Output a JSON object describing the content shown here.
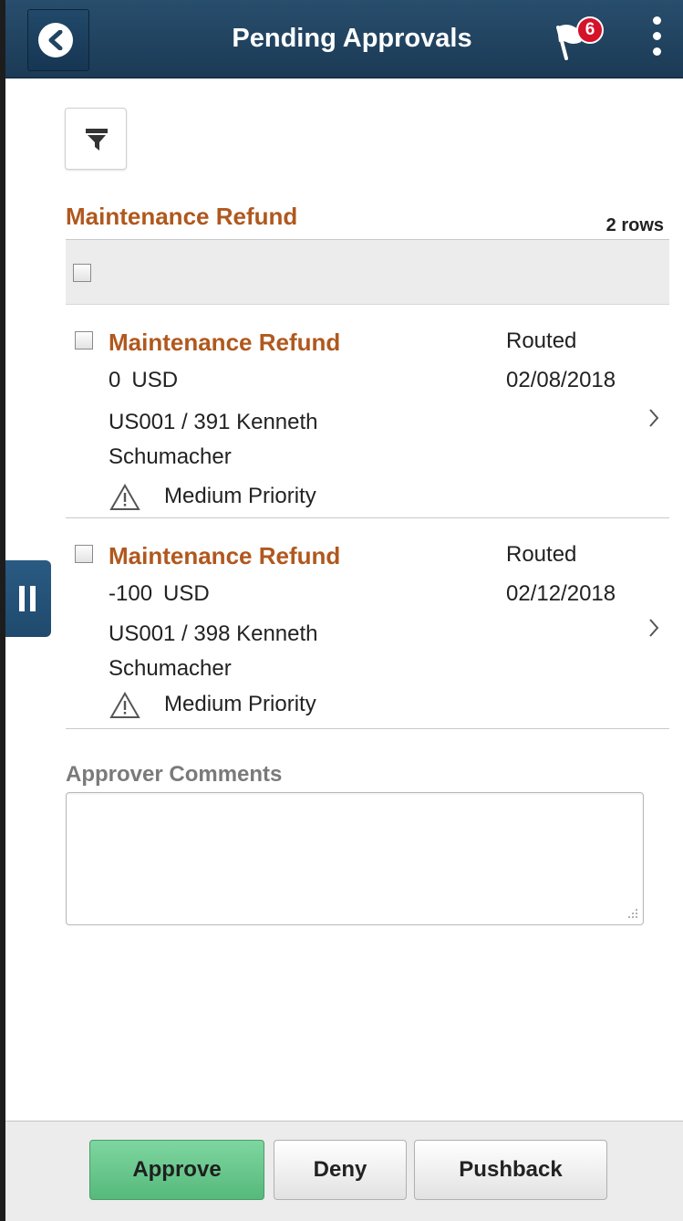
{
  "header": {
    "title": "Pending Approvals",
    "notification_count": "6"
  },
  "section": {
    "title": "Maintenance Refund",
    "row_count": "2 rows"
  },
  "items": [
    {
      "title": "Maintenance Refund",
      "amount": "0",
      "currency": "USD",
      "line1": "US001 / 391  Kenneth",
      "line2": "Schumacher",
      "priority": "Medium Priority",
      "status": "Routed",
      "date": "02/08/2018"
    },
    {
      "title": "Maintenance Refund",
      "amount": "-100",
      "currency": "USD",
      "line1": "US001 / 398  Kenneth",
      "line2": "Schumacher",
      "priority": "Medium Priority",
      "status": "Routed",
      "date": "02/12/2018"
    }
  ],
  "comments": {
    "label": "Approver Comments",
    "value": ""
  },
  "footer": {
    "approve_label": "Approve",
    "deny_label": "Deny",
    "pushback_label": "Pushback"
  },
  "colors": {
    "header_bg": "#1f4563",
    "accent": "#b0581e",
    "approve_bg": "#64c489",
    "badge": "#d4122a"
  },
  "icons": {
    "back": "chevron-left-icon",
    "notifications": "flag-icon",
    "actions": "more-vertical-icon",
    "filter": "filter-icon",
    "priority": "warning-icon",
    "row_detail": "chevron-right-icon",
    "panel_toggle": "pause-icon"
  }
}
